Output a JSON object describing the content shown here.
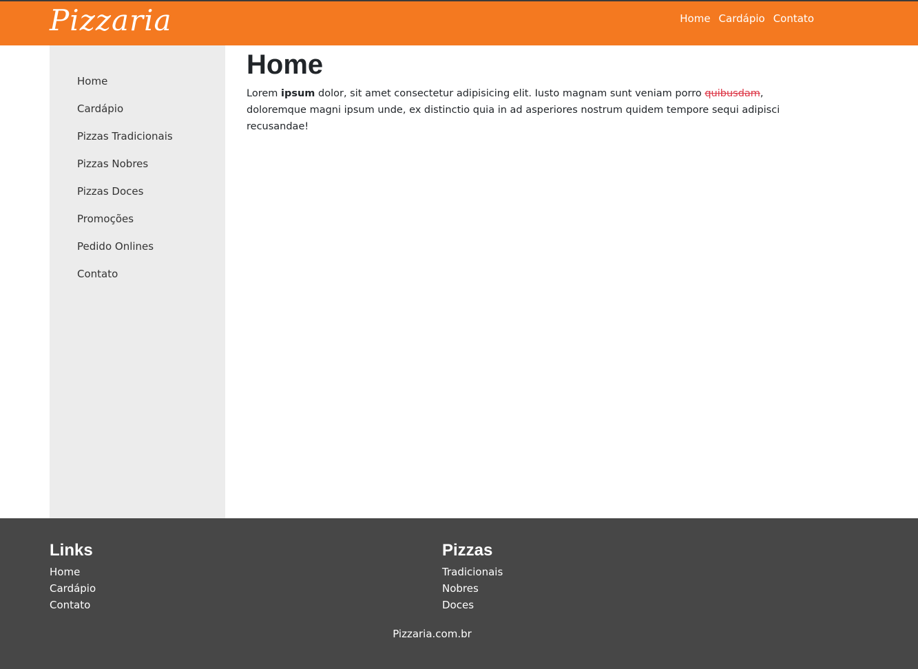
{
  "header": {
    "brand": "Pizzaria",
    "nav": [
      "Home",
      "Cardápio",
      "Contato"
    ]
  },
  "sidebar": {
    "items": [
      "Home",
      "Cardápio",
      "Pizzas Tradicionais",
      "Pizzas Nobres",
      "Pizzas Doces",
      "Promoções",
      "Pedido Onlines",
      "Contato"
    ]
  },
  "main": {
    "title": "Home",
    "paragraph": {
      "text1": "Lorem ",
      "bold": "ipsum",
      "text2": " dolor, sit amet consectetur adipisicing elit. Iusto magnam sunt veniam porro ",
      "strike": "quibusdam",
      "text3": ", doloremque magni ipsum unde, ex distinctio quia in ad asperiores nostrum quidem tempore sequi adipisci recusandae!"
    }
  },
  "footer": {
    "links": {
      "heading": "Links",
      "items": [
        "Home",
        "Cardápio",
        "Contato"
      ]
    },
    "pizzas": {
      "heading": "Pizzas",
      "items": [
        "Tradicionais",
        "Nobres",
        "Doces"
      ]
    },
    "copyright": "Pizzaria.com.br"
  },
  "colors": {
    "header_bg": "#f47920",
    "sidebar_bg": "#ececec",
    "footer_bg": "#474747",
    "strike_text": "#dc3545"
  }
}
